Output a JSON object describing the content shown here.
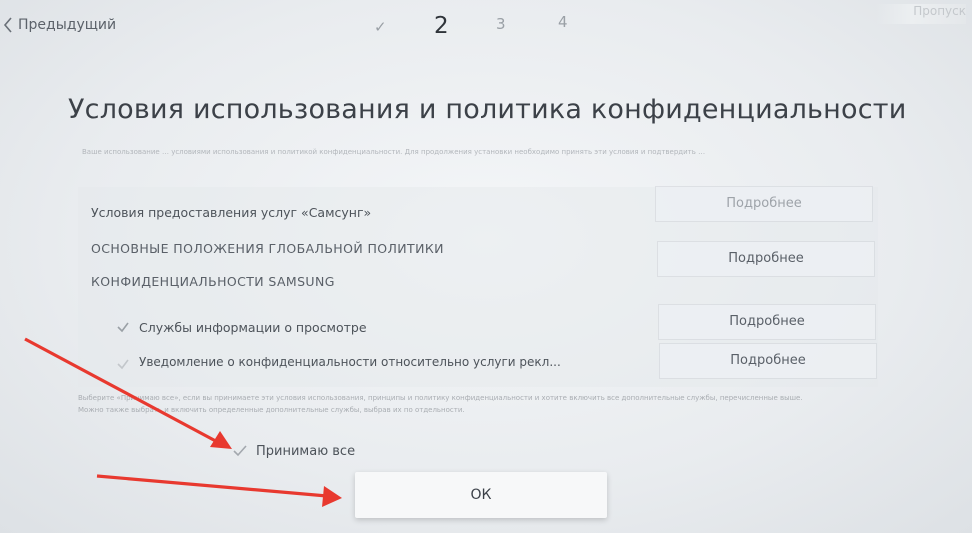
{
  "header": {
    "prev_label": "Предыдущий",
    "steps": [
      "✓",
      "2",
      "3",
      "4"
    ],
    "skip_label": "Пропуск"
  },
  "title": "Условия использования и политика конфиденциальности",
  "intro_text": "Вашe использование … условиями использования и политикой конфиденциальности. Для продолжения установки необходимо принять эти условия и подтвердить …",
  "terms": [
    {
      "label": "Условия предоставления услуг «Самсунг»",
      "details": "Подробнее"
    },
    {
      "label_line1": "ОСНОВНЫЕ ПОЛОЖЕНИЯ ГЛОБАЛЬНОЙ ПОЛИТИКИ",
      "label_line2": "КОНФИДЕНЦИАЛЬНОСТИ SAMSUNG",
      "details": "Подробнее"
    },
    {
      "label": "Службы информации о просмотре",
      "details": "Подробнее"
    },
    {
      "label": "Уведомление о конфиденциальности относительно услуги рекл...",
      "details": "Подробнее"
    }
  ],
  "footer_note": "Выберите «Принимаю все», если вы принимаете эти условия использования, принципы и политику конфиденциальности и хотите включить все дополнительные службы, перечисленные выше. Можно также выбрать и включить определенные дополнительные службы, выбрав их по отдельности.",
  "accept_all_label": "Принимаю все",
  "ok_label": "ОК",
  "colors": {
    "annotation_arrow": "#e8392f",
    "background": "#eceff1"
  }
}
